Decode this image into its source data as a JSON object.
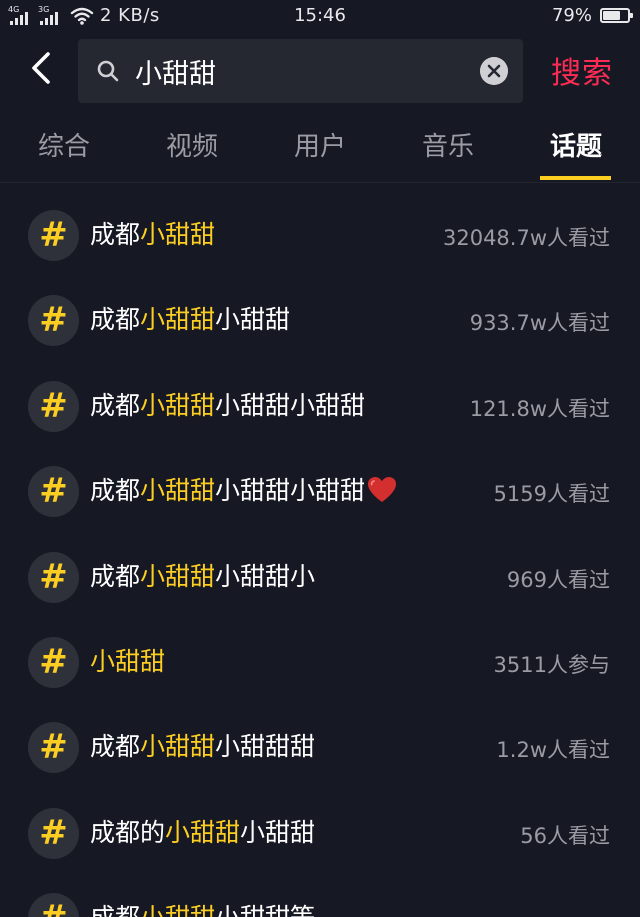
{
  "status_bar": {
    "signal1_label": "4G",
    "signal2_label": "3G",
    "speed": "2 KB/s",
    "time": "15:46",
    "battery_percent": "79%",
    "battery_level": 0.79
  },
  "search": {
    "query": "小甜甜",
    "submit_label": "搜索"
  },
  "tabs": [
    {
      "label": "综合",
      "active": false
    },
    {
      "label": "视频",
      "active": false
    },
    {
      "label": "用户",
      "active": false
    },
    {
      "label": "音乐",
      "active": false
    },
    {
      "label": "话题",
      "active": true
    }
  ],
  "accent_color": "#fdce22",
  "brand_color": "#fe2c55",
  "hash_symbol": "#",
  "results": [
    {
      "prefix": "成都",
      "highlight": "小甜甜",
      "suffix": "",
      "count": "32048.7w人看过"
    },
    {
      "prefix": "成都",
      "highlight": "小甜甜",
      "suffix": "小甜甜",
      "count": "933.7w人看过"
    },
    {
      "prefix": "成都",
      "highlight": "小甜甜",
      "suffix": "小甜甜小甜甜",
      "count": "121.8w人看过"
    },
    {
      "prefix": "成都",
      "highlight": "小甜甜",
      "suffix": "小甜甜小甜甜",
      "emoji": "heart-emoji",
      "count": "5159人看过"
    },
    {
      "prefix": "成都",
      "highlight": "小甜甜",
      "suffix": "小甜甜小",
      "count": "969人看过"
    },
    {
      "prefix": "",
      "highlight": "小甜甜",
      "suffix": "",
      "count": "3511人参与"
    },
    {
      "prefix": "成都",
      "highlight": "小甜甜",
      "suffix": "小甜甜甜",
      "count": "1.2w人看过"
    },
    {
      "prefix": "成都的",
      "highlight": "小甜甜",
      "suffix": "小甜甜",
      "count": "56人看过"
    },
    {
      "prefix": "成都",
      "highlight": "小甜甜",
      "suffix": "小甜甜等",
      "count": ""
    }
  ]
}
